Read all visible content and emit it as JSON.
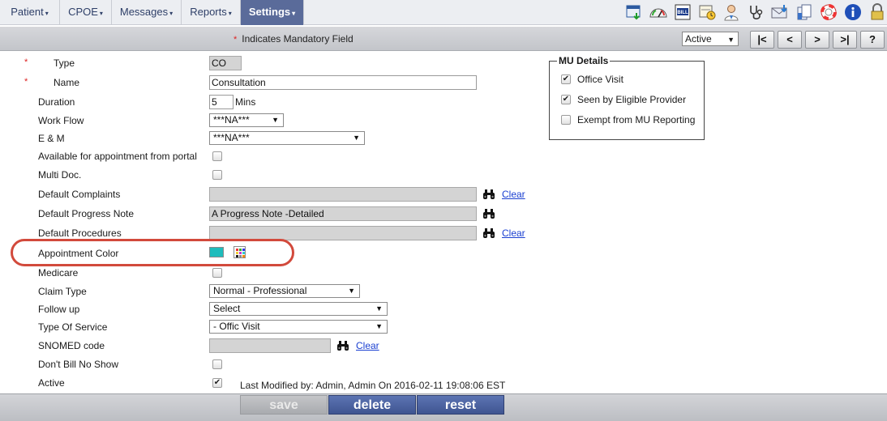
{
  "nav": {
    "tabs": [
      {
        "label": "Patient"
      },
      {
        "label": "CPOE"
      },
      {
        "label": "Messages"
      },
      {
        "label": "Reports"
      },
      {
        "label": "Settings"
      }
    ],
    "caret": "▾",
    "icons": [
      "calendar-download-icon",
      "dashboard-gauge-icon",
      "bill-icon",
      "schedule-clock-icon",
      "doctor-user-icon",
      "stethoscope-icon",
      "mail-download-icon",
      "documents-icon",
      "lifebuoy-help-icon",
      "info-icon",
      "lock-icon"
    ]
  },
  "subbar": {
    "mandatory_star": "*",
    "mandatory_text": "Indicates Mandatory Field",
    "status_value": "Active",
    "nav_first": "|<",
    "nav_prev": "<",
    "nav_next": ">",
    "nav_last": ">|",
    "help": "?"
  },
  "form": {
    "type_label": "Type",
    "type_value": "CO",
    "name_label": "Name",
    "name_value": "Consultation",
    "duration_label": "Duration",
    "duration_value": "5",
    "duration_unit": "Mins",
    "workflow_label": "Work Flow",
    "workflow_value": "***NA***",
    "em_label": "E & M",
    "em_value": "***NA***",
    "portal_label": "Available for appointment from portal",
    "multidoc_label": "Multi Doc.",
    "complaints_label": "Default Complaints",
    "complaints_value": "",
    "progress_note_label": "Default Progress Note",
    "progress_note_value": "A Progress Note -Detailed",
    "procedures_label": "Default Procedures",
    "procedures_value": "",
    "appointment_color_label": "Appointment Color",
    "appointment_color": "#1fbcbc",
    "medicare_label": "Medicare",
    "claim_type_label": "Claim Type",
    "claim_type_value": "Normal - Professional",
    "followup_label": "Follow up",
    "followup_value": "Select",
    "type_of_service_label": "Type Of Service",
    "type_of_service_value": "- Offic Visit",
    "snomed_label": "SNOMED code",
    "snomed_value": "",
    "dont_bill_label": "Don't Bill No Show",
    "active_label": "Active",
    "clear_link": "Clear",
    "check_mark": "✔",
    "last_modified": "Last Modified by: Admin, Admin On 2016-02-11 19:08:06 EST"
  },
  "mu": {
    "title": "MU Details",
    "office_visit": "Office Visit",
    "eligible_provider": "Seen by Eligible Provider",
    "exempt": "Exempt from MU Reporting"
  },
  "actions": {
    "save": "save",
    "delete": "delete",
    "reset": "reset"
  },
  "colors": {
    "accent": "#5a6b9a",
    "required": "#dd2222",
    "link": "#1a3fd1",
    "highlight": "#d24a3c"
  }
}
